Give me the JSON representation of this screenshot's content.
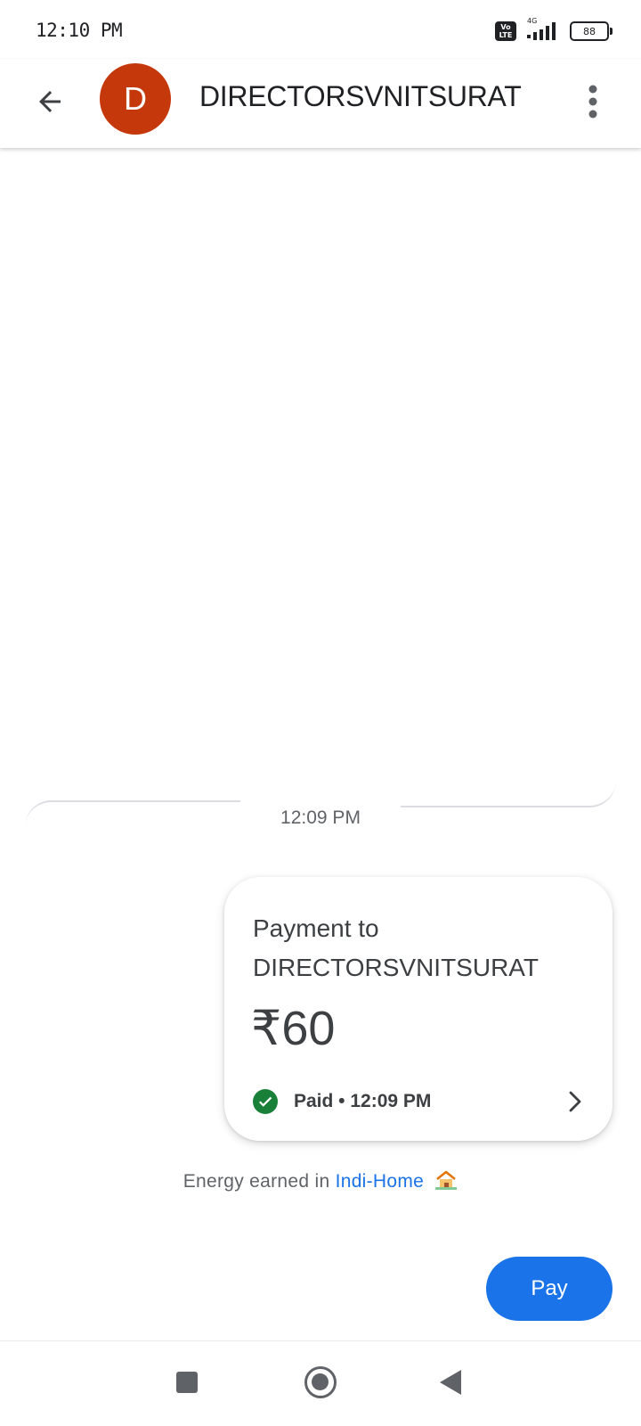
{
  "status_bar": {
    "time": "12:10 PM",
    "network_label": "4G",
    "volte_label": "Vo LTE",
    "battery_level": "88"
  },
  "header": {
    "avatar_initial": "D",
    "contact_name": "DIRECTORSVNITSURAT",
    "icons": {
      "back": "arrow-left-icon",
      "more": "more-vert-icon"
    },
    "avatar_color": "#c5380c"
  },
  "conversation": {
    "divider_time": "12:09 PM",
    "payment": {
      "title": "Payment to DIRECTORSVNITSURAT",
      "amount": "₹60",
      "status": "Paid • 12:09 PM",
      "status_color": "#188038"
    },
    "energy": {
      "prefix": "Energy earned in",
      "link": "Indi-Home",
      "emoji": "🏡"
    }
  },
  "actions": {
    "pay_label": "Pay",
    "pay_color": "#1a73e8"
  },
  "nav": {
    "icons": [
      "recents-square-icon",
      "home-circle-icon",
      "back-triangle-icon"
    ]
  }
}
